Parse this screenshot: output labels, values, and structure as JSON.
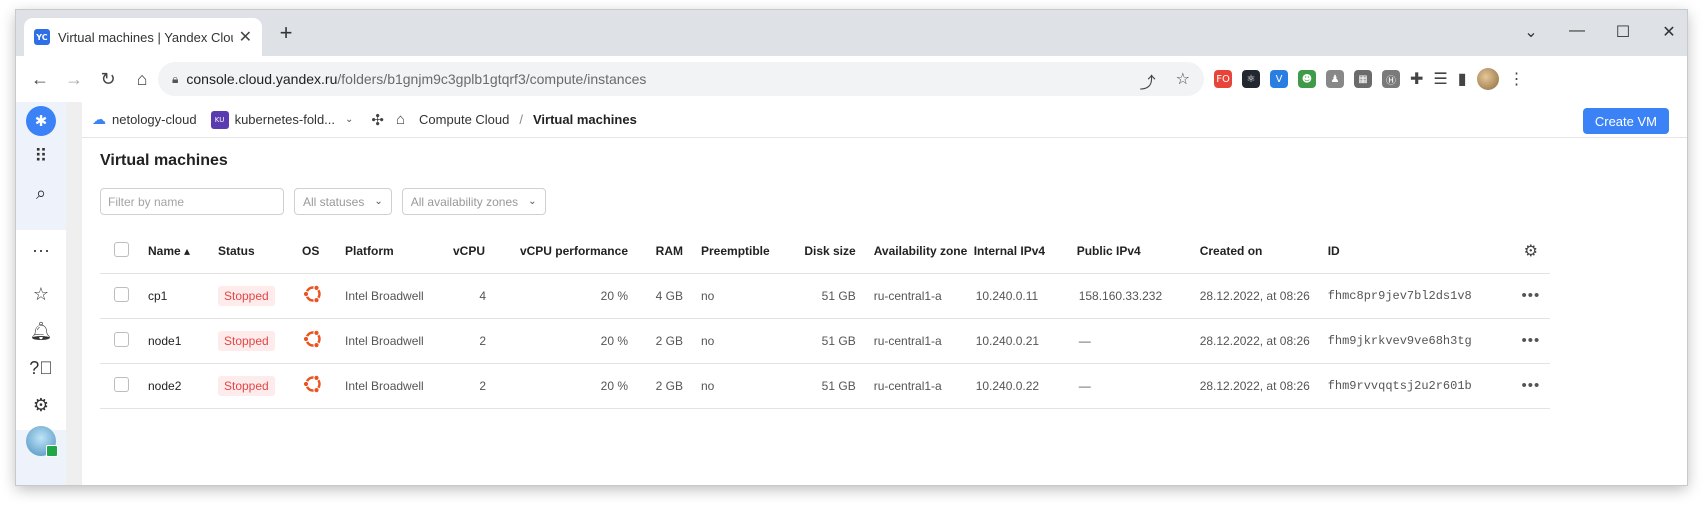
{
  "browser": {
    "tab_title": "Virtual machines | Yandex Cloud",
    "favicon_text": "YC",
    "url_host": "console.cloud.yandex.ru",
    "url_path": "/folders/b1gnjm9c3gplb1gtqrf3/compute/instances",
    "extensions": [
      {
        "name": "fo-extension-icon",
        "text": "FO",
        "color": "#e8443a"
      },
      {
        "name": "react-devtools-icon",
        "text": "⚛",
        "color": "#23272f"
      },
      {
        "name": "shield-extension-icon",
        "text": "V",
        "color": "#2a7de1"
      },
      {
        "name": "person-extension-icon",
        "text": "☻",
        "color": "#3f9b4a"
      },
      {
        "name": "profile-extension-icon",
        "text": "♟",
        "color": "#888888"
      },
      {
        "name": "clipboard-extension-icon",
        "text": "▦",
        "color": "#6b6b6b"
      },
      {
        "name": "circle-h-extension-icon",
        "text": "Ⓗ",
        "color": "#7a7a7a"
      }
    ]
  },
  "header": {
    "cloud_name": "netology-cloud",
    "folder_badge": "KU",
    "folder_name": "kubernetes-fold...",
    "service": "Compute Cloud",
    "current_page": "Virtual machines",
    "create_label": "Create VM"
  },
  "main": {
    "title": "Virtual machines",
    "filter_placeholder": "Filter by name",
    "status_filter": "All statuses",
    "zone_filter": "All availability zones"
  },
  "table": {
    "columns": {
      "name": "Name ▴",
      "status": "Status",
      "os": "OS",
      "platform": "Platform",
      "vcpu": "vCPU",
      "perf": "vCPU performance",
      "ram": "RAM",
      "preemptible": "Preemptible",
      "disk": "Disk size",
      "zone": "Availability zone",
      "internal_ip": "Internal IPv4",
      "public_ip": "Public IPv4",
      "created": "Created on",
      "id": "ID"
    },
    "rows": [
      {
        "name": "cp1",
        "status": "Stopped",
        "platform": "Intel Broadwell",
        "vcpu": "4",
        "perf": "20 %",
        "ram": "4 GB",
        "preemptible": "no",
        "disk": "51 GB",
        "zone": "ru-central1-a",
        "internal_ip": "10.240.0.11",
        "public_ip": "158.160.33.232",
        "created": "28.12.2022, at 08:26",
        "id": "fhmc8pr9jev7bl2ds1v8"
      },
      {
        "name": "node1",
        "status": "Stopped",
        "platform": "Intel Broadwell",
        "vcpu": "2",
        "perf": "20 %",
        "ram": "2 GB",
        "preemptible": "no",
        "disk": "51 GB",
        "zone": "ru-central1-a",
        "internal_ip": "10.240.0.21",
        "public_ip": "—",
        "created": "28.12.2022, at 08:26",
        "id": "fhm9jkrkvev9ve68h3tg"
      },
      {
        "name": "node2",
        "status": "Stopped",
        "platform": "Intel Broadwell",
        "vcpu": "2",
        "perf": "20 %",
        "ram": "2 GB",
        "preemptible": "no",
        "disk": "51 GB",
        "zone": "ru-central1-a",
        "internal_ip": "10.240.0.22",
        "public_ip": "—",
        "created": "28.12.2022, at 08:26",
        "id": "fhm9rvvqqtsj2u2r601b"
      }
    ]
  },
  "colors": {
    "accent": "#3b82f6",
    "stopped_text": "#e54545",
    "stopped_bg": "#fdeceb",
    "ubuntu": "#e95420"
  }
}
